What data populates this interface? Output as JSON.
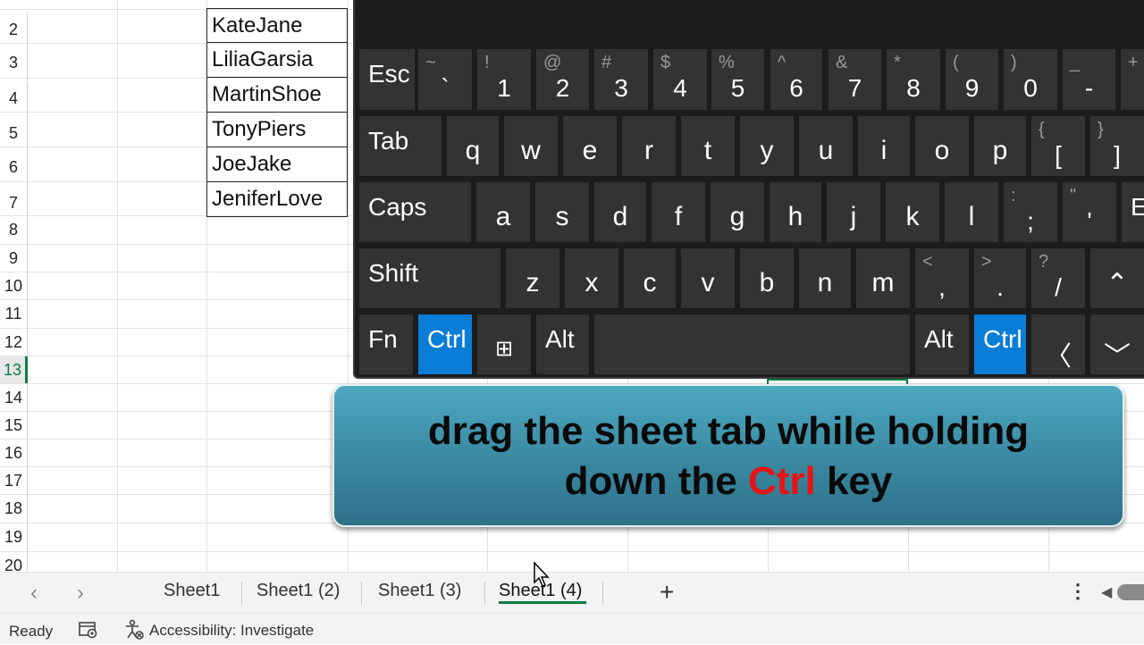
{
  "grid": {
    "row_numbers": [
      "2",
      "3",
      "4",
      "5",
      "6",
      "7",
      "8",
      "9",
      "10",
      "11",
      "12",
      "13",
      "14",
      "15",
      "16",
      "17",
      "18",
      "19",
      "20"
    ],
    "active_row": "13",
    "names": [
      "KateJane",
      "LiliaGarsia",
      "MartinShoe",
      "TonyPiers",
      "JoeJake",
      "JeniferLove"
    ]
  },
  "keyboard": {
    "row1": [
      {
        "main": "Esc"
      },
      {
        "shift": "~",
        "base": "`"
      },
      {
        "shift": "!",
        "base": "1"
      },
      {
        "shift": "@",
        "base": "2"
      },
      {
        "shift": "#",
        "base": "3"
      },
      {
        "shift": "$",
        "base": "4"
      },
      {
        "shift": "%",
        "base": "5"
      },
      {
        "shift": "^",
        "base": "6"
      },
      {
        "shift": "&",
        "base": "7"
      },
      {
        "shift": "*",
        "base": "8"
      },
      {
        "shift": "(",
        "base": "9"
      },
      {
        "shift": ")",
        "base": "0"
      },
      {
        "shift": "_",
        "base": "-"
      },
      {
        "shift": "+",
        "base": ""
      }
    ],
    "row2": [
      {
        "main": "Tab"
      },
      {
        "main": "q"
      },
      {
        "main": "w"
      },
      {
        "main": "e"
      },
      {
        "main": "r"
      },
      {
        "main": "t"
      },
      {
        "main": "y"
      },
      {
        "main": "u"
      },
      {
        "main": "i"
      },
      {
        "main": "o"
      },
      {
        "main": "p"
      },
      {
        "shift": "{",
        "base": "["
      },
      {
        "shift": "}",
        "base": "]"
      }
    ],
    "row3": [
      {
        "main": "Caps"
      },
      {
        "main": "a"
      },
      {
        "main": "s"
      },
      {
        "main": "d"
      },
      {
        "main": "f"
      },
      {
        "main": "g"
      },
      {
        "main": "h"
      },
      {
        "main": "j"
      },
      {
        "main": "k"
      },
      {
        "main": "l"
      },
      {
        "shift": ":",
        "base": ";"
      },
      {
        "shift": "\"",
        "base": "'"
      },
      {
        "main": "Er"
      }
    ],
    "row4": [
      {
        "main": "Shift"
      },
      {
        "main": "z"
      },
      {
        "main": "x"
      },
      {
        "main": "c"
      },
      {
        "main": "v"
      },
      {
        "main": "b"
      },
      {
        "main": "n"
      },
      {
        "main": "m"
      },
      {
        "shift": "<",
        "base": ","
      },
      {
        "shift": ">",
        "base": "."
      },
      {
        "shift": "?",
        "base": "/"
      },
      {
        "main": "⌃"
      }
    ],
    "row5": [
      {
        "main": "Fn"
      },
      {
        "main": "Ctrl",
        "highlight": true
      },
      {
        "main": "⊞"
      },
      {
        "main": "Alt"
      },
      {
        "main": ""
      },
      {
        "main": "Alt"
      },
      {
        "main": "Ctrl",
        "highlight": true
      },
      {
        "main": "〈"
      },
      {
        "main": "﹀"
      }
    ]
  },
  "banner": {
    "line1": "drag the sheet tab while holding",
    "line2_pre": "down the ",
    "line2_highlight": "Ctrl",
    "line2_post": " key",
    "highlight_color": "#e81313"
  },
  "tabs": {
    "nav_prev": "‹",
    "nav_next": "›",
    "items": [
      "Sheet1",
      "Sheet1 (2)",
      "Sheet1 (3)",
      "Sheet1 (4)"
    ],
    "active": "Sheet1 (4)",
    "add": "+",
    "more": "⋮",
    "scroll_left": "◀"
  },
  "status": {
    "ready": "Ready",
    "accessibility": "Accessibility: Investigate"
  },
  "colors": {
    "excel_green": "#107c41",
    "ctrl_key_blue": "#0a7dd6",
    "keyboard_bg": "#1c1c1c",
    "key_bg": "#333333",
    "banner_teal": "#3c8ea6"
  }
}
